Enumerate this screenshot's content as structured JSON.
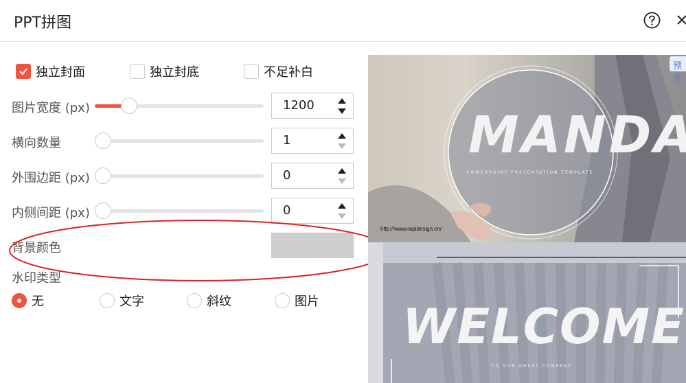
{
  "header": {
    "title": "PPT拼图"
  },
  "options": [
    {
      "label": "独立封面",
      "checked": true
    },
    {
      "label": "独立封底",
      "checked": false
    },
    {
      "label": "不足补白",
      "checked": false
    }
  ],
  "rows": {
    "width": {
      "label": "图片宽度 (px)",
      "value": "1200",
      "fill_fraction": 0.17
    },
    "columns": {
      "label": "横向数量",
      "value": "1",
      "fill_fraction": 0
    },
    "outer_margin": {
      "label": "外围边距 (px)",
      "value": "0",
      "fill_fraction": 0
    },
    "inner_spacing": {
      "label": "内侧间距 (px)",
      "value": "0",
      "fill_fraction": 0
    }
  },
  "background": {
    "label": "背景颜色",
    "color": "#cfcfcf"
  },
  "watermark": {
    "label": "水印类型",
    "options": [
      {
        "label": "无",
        "selected": true
      },
      {
        "label": "文字",
        "selected": false
      },
      {
        "label": "斜纹",
        "selected": false
      },
      {
        "label": "图片",
        "selected": false
      }
    ]
  },
  "preview": {
    "badge": "预览",
    "slide1": {
      "title": "MANDA",
      "subtitle": "POWERPOINT PRESENTATION TEMPLATE",
      "url": "http://www.rapidesign.cn/"
    },
    "slide2": {
      "title": "WELCOME",
      "subtitle": "TO OUR GREAT COMPANY"
    }
  },
  "colors": {
    "accent": "#f0533e",
    "annotation": "#e02020"
  }
}
